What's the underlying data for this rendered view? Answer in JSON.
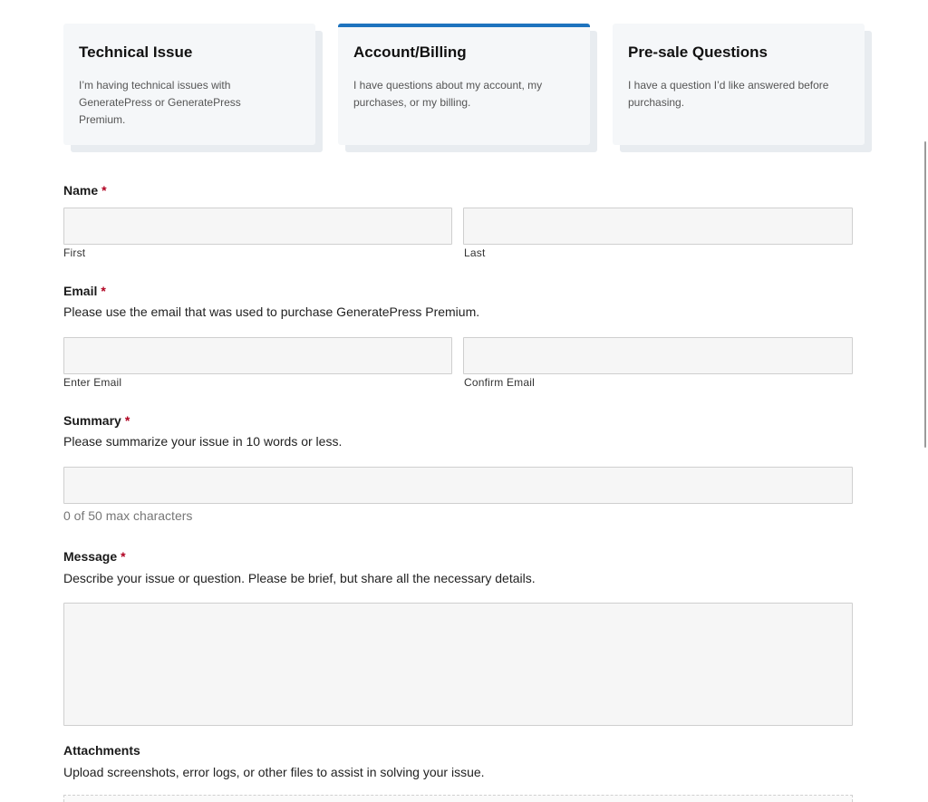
{
  "cards": [
    {
      "title": "Technical Issue",
      "description": "I’m having technical issues with GeneratePress or GeneratePress Premium.",
      "active": false
    },
    {
      "title": "Account/Billing",
      "description": "I have questions about my account, my purchases, or my billing.",
      "active": true
    },
    {
      "title": "Pre-sale Questions",
      "description": "I have a question I’d like answered before purchasing.",
      "active": false
    }
  ],
  "form": {
    "name": {
      "label": "Name",
      "required": "*",
      "first_sublabel": "First",
      "last_sublabel": "Last",
      "first_value": "",
      "last_value": ""
    },
    "email": {
      "label": "Email",
      "required": "*",
      "description": "Please use the email that was used to purchase GeneratePress Premium.",
      "enter_sublabel": "Enter Email",
      "confirm_sublabel": "Confirm Email",
      "enter_value": "",
      "confirm_value": ""
    },
    "summary": {
      "label": "Summary",
      "required": "*",
      "description": "Please summarize your issue in 10 words or less.",
      "value": "",
      "counter": "0 of 50 max characters"
    },
    "message": {
      "label": "Message",
      "required": "*",
      "description": "Describe your issue or question. Please be brief, but share all the necessary details.",
      "value": ""
    },
    "attachments": {
      "label": "Attachments",
      "description": "Upload screenshots, error logs, or other files to assist in solving your issue."
    }
  },
  "colors": {
    "accent": "#1e73be",
    "required": "#b00020",
    "input_bg": "#f6f6f6",
    "card_bg": "#f5f7f9"
  }
}
